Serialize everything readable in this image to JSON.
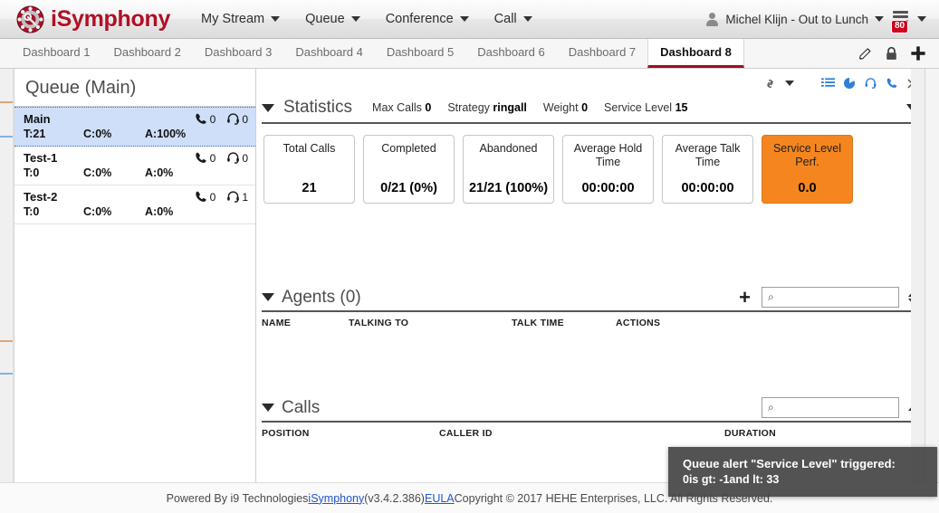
{
  "app": {
    "brand": "iSymphony",
    "logo_icon": "rotary-phone-dial-icon"
  },
  "topnav": {
    "items": [
      {
        "label": "My Stream",
        "icon": "chevron-down-icon"
      },
      {
        "label": "Queue",
        "icon": "chevron-down-icon"
      },
      {
        "label": "Conference",
        "icon": "chevron-down-icon"
      },
      {
        "label": "Call",
        "icon": "chevron-down-icon"
      }
    ],
    "user": {
      "label": "Michel Klijn - Out to Lunch",
      "avatar_icon": "user-avatar-icon",
      "caret_icon": "chevron-down-icon"
    },
    "queue_menu": {
      "icon": "list-lines-icon",
      "badge": "80",
      "badge_color": "#d0021b",
      "caret_icon": "chevron-down-icon"
    }
  },
  "tabs": {
    "items": [
      {
        "label": "Dashboard 1",
        "active": false
      },
      {
        "label": "Dashboard 2",
        "active": false
      },
      {
        "label": "Dashboard 3",
        "active": false
      },
      {
        "label": "Dashboard 4",
        "active": false
      },
      {
        "label": "Dashboard 5",
        "active": false
      },
      {
        "label": "Dashboard 6",
        "active": false
      },
      {
        "label": "Dashboard 7",
        "active": false
      },
      {
        "label": "Dashboard 8",
        "active": true
      }
    ],
    "active_underline_color": "#9c1022",
    "actions": [
      {
        "icon": "pencil-edit-icon"
      },
      {
        "icon": "lock-icon"
      },
      {
        "icon": "plus-add-icon"
      }
    ]
  },
  "queue_panel": {
    "title": "Queue (Main)",
    "toolbar": [
      {
        "icon": "link-chain-icon",
        "color": "#444"
      },
      {
        "icon": "chevron-down-icon",
        "color": "#444"
      },
      {
        "icon": "list-view-icon",
        "color": "#2f7fd9"
      },
      {
        "icon": "refresh-pie-icon",
        "color": "#2f7fd9"
      },
      {
        "icon": "headset-icon",
        "color": "#2f7fd9"
      },
      {
        "icon": "phone-handset-icon",
        "color": "#2f7fd9"
      },
      {
        "icon": "close-x-icon",
        "color": "#666"
      }
    ],
    "rows": [
      {
        "name": "Main",
        "selected": true,
        "total": "T:21",
        "completed": "C:0%",
        "abandoned": "A:100%",
        "calls": "0",
        "agents": "0"
      },
      {
        "name": "Test-1",
        "selected": false,
        "total": "T:0",
        "completed": "C:0%",
        "abandoned": "A:0%",
        "calls": "0",
        "agents": "0"
      },
      {
        "name": "Test-2",
        "selected": false,
        "total": "T:0",
        "completed": "C:0%",
        "abandoned": "A:0%",
        "calls": "0",
        "agents": "1"
      }
    ]
  },
  "statistics": {
    "title": "Statistics",
    "inline": [
      {
        "label": "Max Calls",
        "value": "0"
      },
      {
        "label": "Strategy",
        "value": "ringall"
      },
      {
        "label": "Weight",
        "value": "0"
      },
      {
        "label": "Service Level",
        "value": "15"
      }
    ],
    "cards": [
      {
        "label": "Total Calls",
        "value": "21",
        "alert": false
      },
      {
        "label": "Completed",
        "value": "0/21 (0%)",
        "alert": false
      },
      {
        "label": "Abandoned",
        "value": "21/21 (100%)",
        "alert": false
      },
      {
        "label": "Average Hold Time",
        "value": "00:00:00",
        "alert": false
      },
      {
        "label": "Average Talk Time",
        "value": "00:00:00",
        "alert": false
      },
      {
        "label": "Service Level Perf.",
        "value": "0.0",
        "alert": true
      }
    ],
    "alert_color": "#f5861f"
  },
  "agents": {
    "title": "Agents (0)",
    "add_label": "+",
    "search_value": "",
    "search_placeholder": "",
    "columns": [
      "NAME",
      "TALKING TO",
      "TALK TIME",
      "ACTIONS"
    ],
    "rows": []
  },
  "calls": {
    "title": "Calls",
    "search_value": "",
    "search_placeholder": "",
    "columns": [
      "POSITION",
      "CALLER ID",
      "DURATION"
    ],
    "rows": []
  },
  "footer": {
    "prefix": "Powered By i9 Technologies ",
    "link_app": "iSymphony",
    "version": " (v3.4.2.386) ",
    "link_eula": "EULA",
    "copyright": " Copyright © 2017 HEHE Enterprises, LLC. All Rights Reserved."
  },
  "toast": {
    "title": "Queue alert \"Service Level\" triggered:",
    "body": "0is gt: -1and lt: 33"
  }
}
